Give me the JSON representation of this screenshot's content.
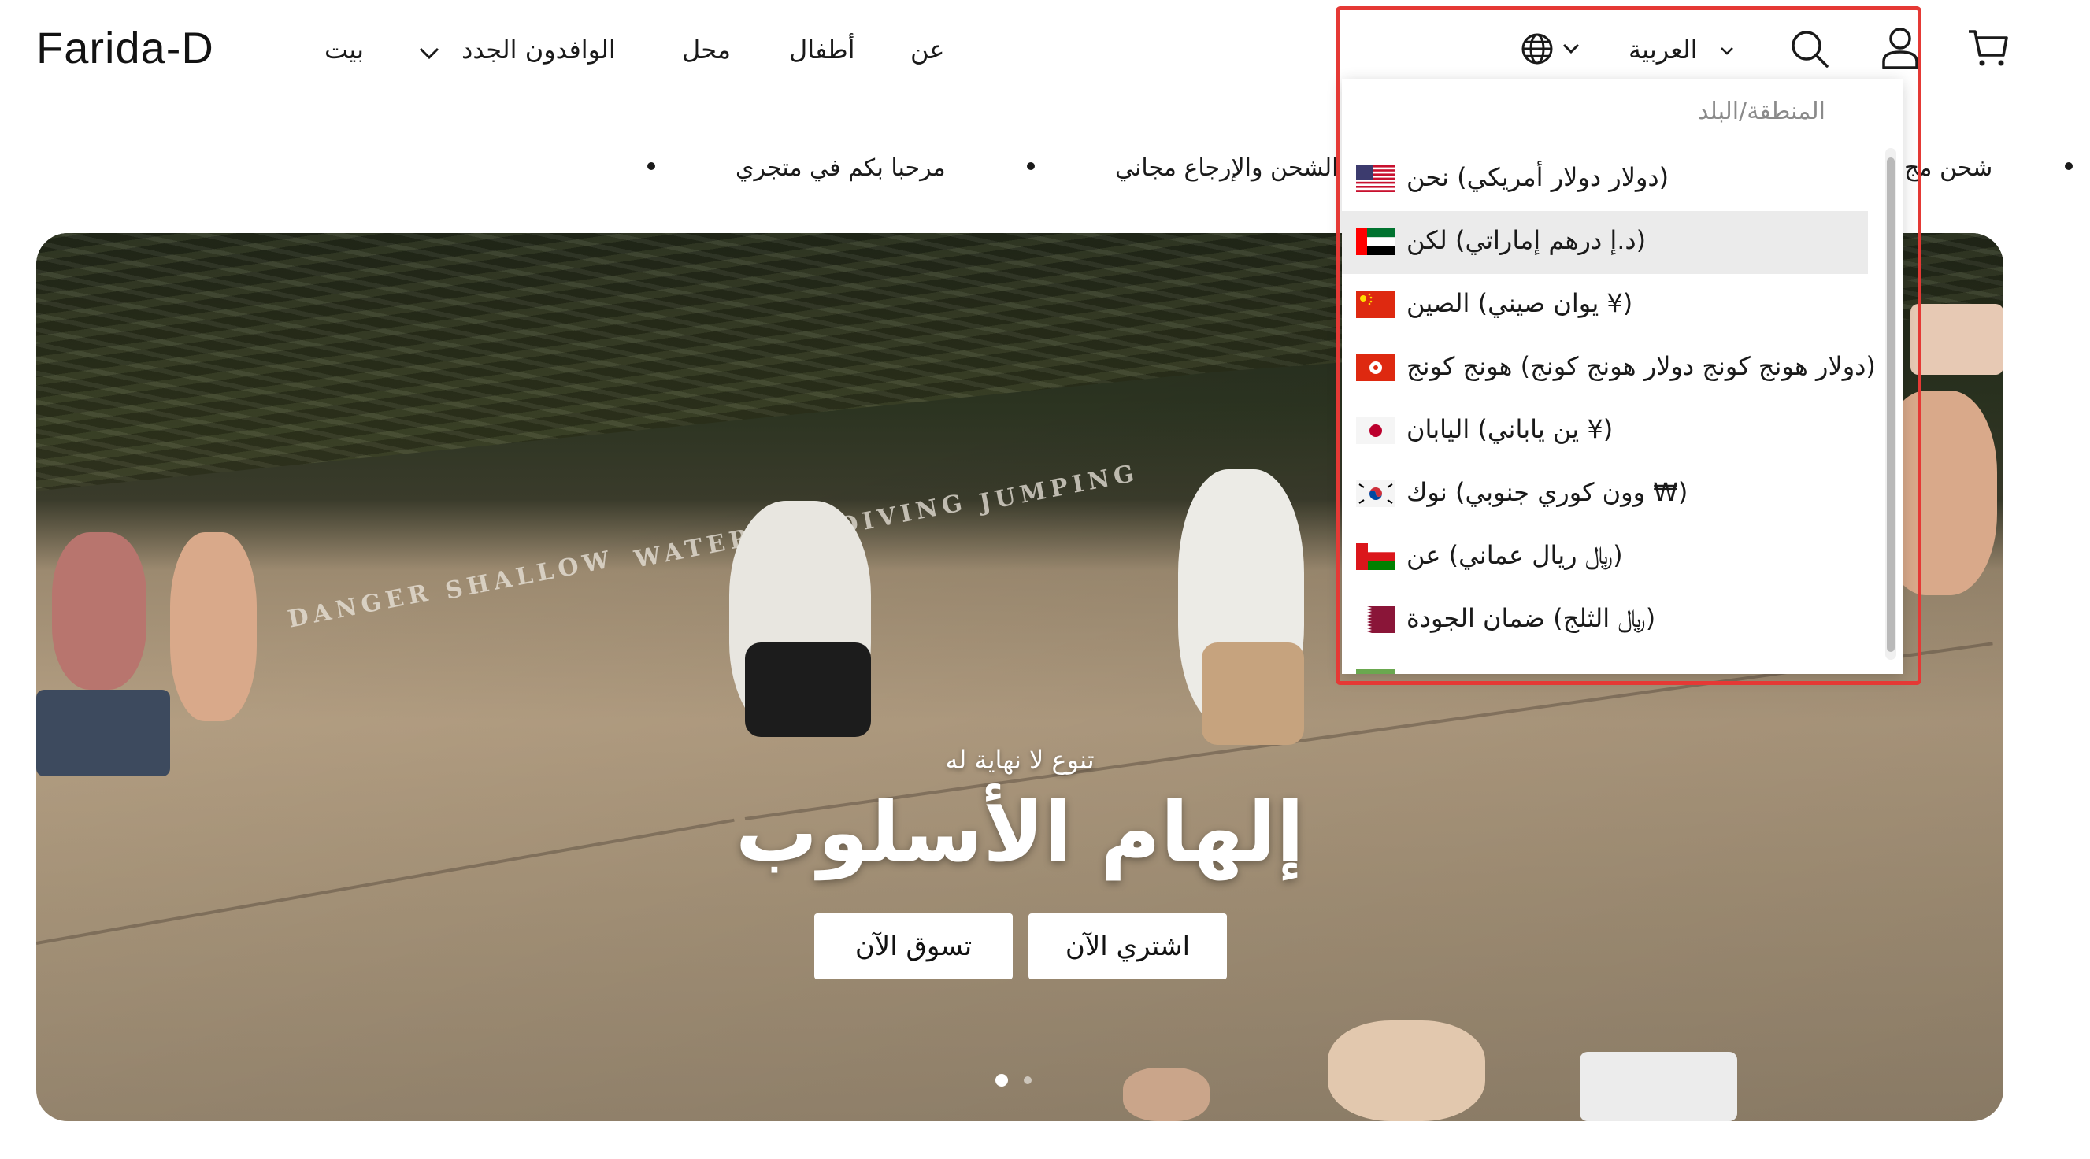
{
  "header": {
    "logo": "Farida-D",
    "nav": [
      {
        "label": "بيت"
      },
      {
        "label": "الوافدون الجدد"
      },
      {
        "label": "محل"
      },
      {
        "label": "أطفال"
      },
      {
        "label": "عن"
      }
    ],
    "language_selector": "العربية",
    "icons": [
      "globe-icon",
      "chevron-down-icon",
      "search-icon",
      "account-icon",
      "cart-icon"
    ]
  },
  "announcement": {
    "items": [
      "شحن مج",
      "الشحن والإرجاع مجاني",
      "مرحبا بكم في متجري"
    ]
  },
  "hero": {
    "pier_text": [
      "DANGER",
      "SHALLOW",
      "WATER",
      "DIVING",
      "JUMPING"
    ],
    "subtitle": "تنوع لا نهاية له",
    "title": "إلهام الأسلوب",
    "buttons": {
      "buy_now": "اشتري الآن",
      "shop_now": "تسوق الآن"
    },
    "slides": 2,
    "active_slide": 1
  },
  "country_dropdown": {
    "title": "المنطقة/البلد",
    "items": [
      {
        "label": "(دولار دولار أمريكي) نحن",
        "flag": "us"
      },
      {
        "label": "(د.إ درهم إماراتي) لكن",
        "flag": "ae",
        "active": true
      },
      {
        "label": "(¥ يوان صيني) الصين",
        "flag": "cn"
      },
      {
        "label": "(دولار هونج كونج دولار هونج كونج) هونج كونج",
        "flag": "hk"
      },
      {
        "label": "(¥ ين ياباني) اليابان",
        "flag": "jp"
      },
      {
        "label": "(₩ وون كوري جنوبي) نوك",
        "flag": "kr"
      },
      {
        "label": "(﷼ ريال عماني) عن",
        "flag": "om"
      },
      {
        "label": "(﷼ الثلج) ضمان الجودة",
        "flag": "qa"
      }
    ]
  },
  "colors": {
    "highlight": "#e53935",
    "active_row": "#ebebeb"
  }
}
